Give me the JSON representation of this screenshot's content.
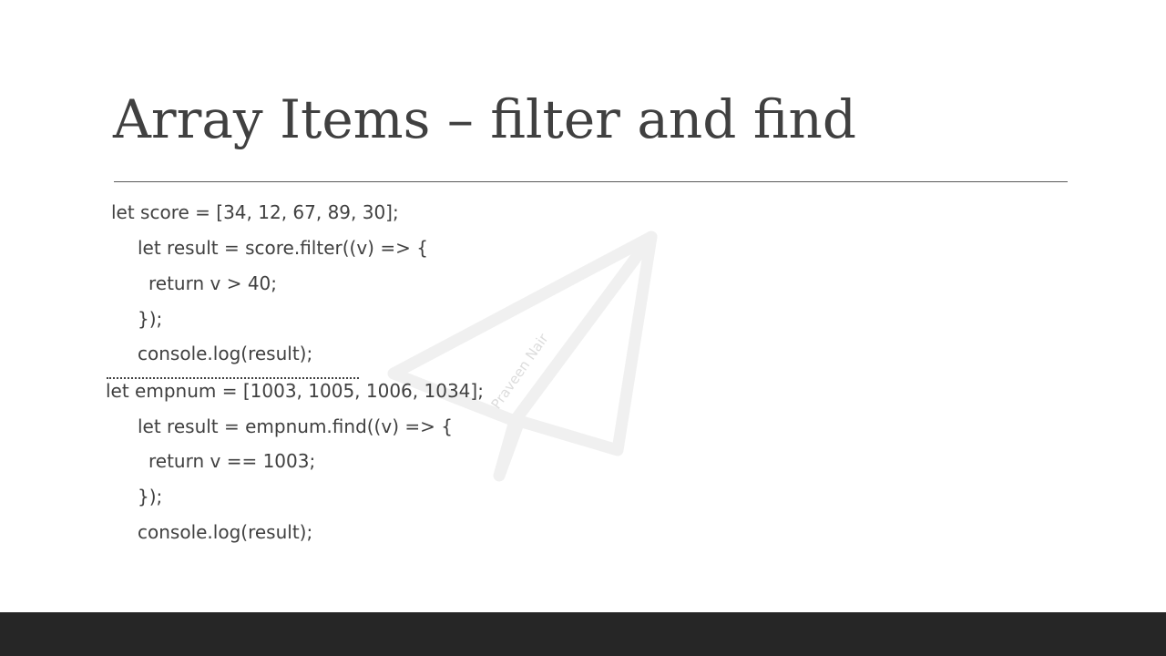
{
  "slide": {
    "title": "Array Items – filter and find",
    "watermark_text": "Praveen Nair",
    "code_lines": [
      "let score = [34, 12, 67, 89, 30];",
      "let result = score.filter((v) => {",
      "return v > 40;",
      "});",
      "console.log(result);",
      "let empnum = [1003, 1005, 1006, 1034];",
      "let result = empnum.find((v) => {",
      "return v == 1003;",
      "});",
      "console.log(result);"
    ]
  },
  "colors": {
    "text": "#404040",
    "footer": "#262626",
    "watermark": "#f0f0f0"
  }
}
